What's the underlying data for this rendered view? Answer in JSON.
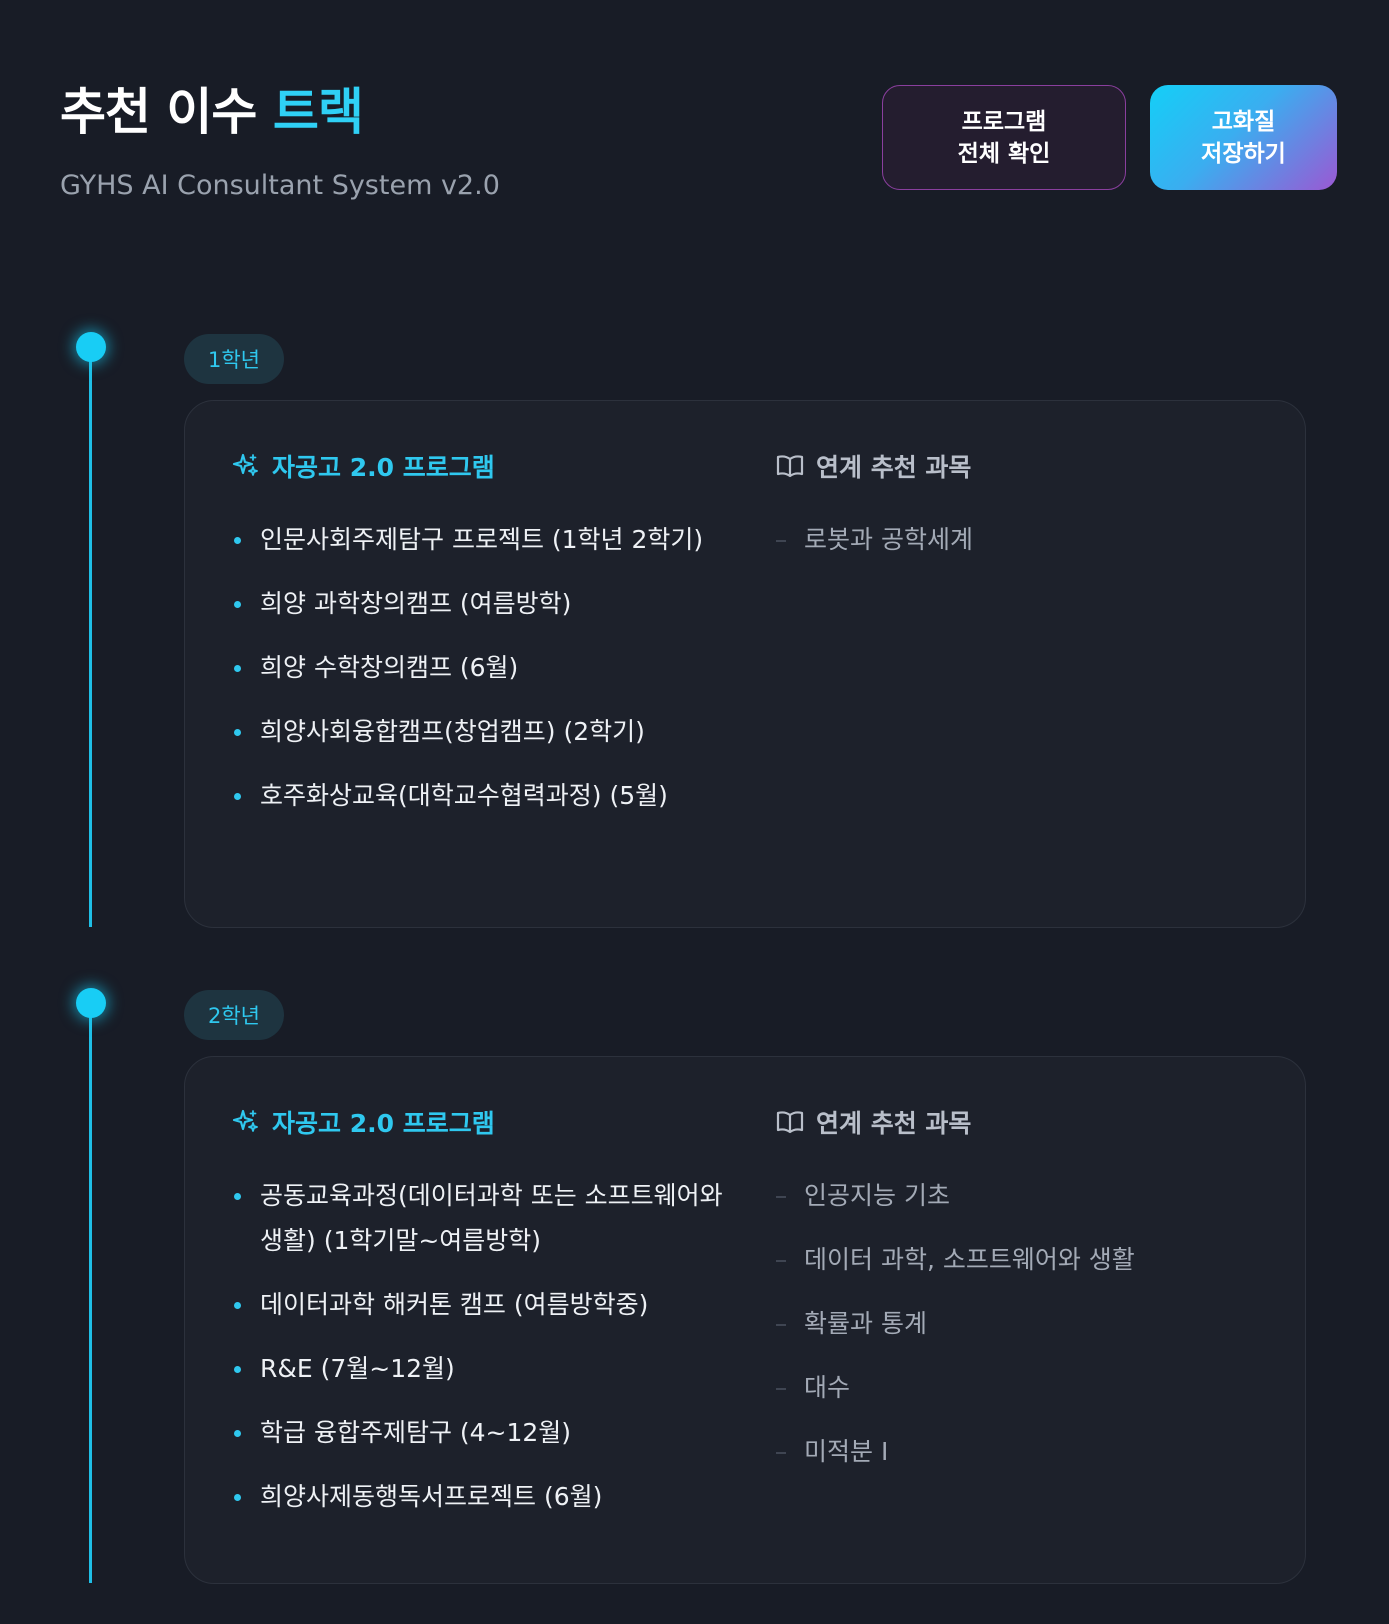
{
  "header": {
    "title_main": "추천 이수",
    "title_accent": "트랙",
    "subtitle": "GYHS AI Consultant System v2.0",
    "buttons": {
      "view_all": [
        "프로그램",
        "전체 확인"
      ],
      "save_hq": [
        "고화질",
        "저장하기"
      ]
    }
  },
  "colors": {
    "background": "#181c26",
    "accent": "#2fc8ef",
    "card": "#1d212b",
    "save_gradient": [
      "#14cff7",
      "#9b58d3"
    ]
  },
  "grades": [
    {
      "label": "1학년",
      "program_heading": "자공고 2.0 프로그램",
      "program_icon": "sparkle-icon",
      "course_heading": "연계 추천 과목",
      "course_icon": "book-icon",
      "programs": [
        "인문사회주제탐구 프로젝트 (1학년 2학기)",
        "희양 과학창의캠프 (여름방학)",
        "희양 수학창의캠프 (6월)",
        "희양사회융합캠프(창업캠프) (2학기)",
        "호주화상교육(대학교수협력과정) (5월)"
      ],
      "courses": [
        "로봇과 공학세계"
      ]
    },
    {
      "label": "2학년",
      "program_heading": "자공고 2.0 프로그램",
      "program_icon": "sparkle-icon",
      "course_heading": "연계 추천 과목",
      "course_icon": "book-icon",
      "programs": [
        "공동교육과정(데이터과학 또는 소프트웨어와 생활) (1학기말~여름방학)",
        "데이터과학 해커톤 캠프 (여름방학중)",
        "R&E (7월~12월)",
        "학급 융합주제탐구 (4~12월)",
        "희양사제동행독서프로젝트 (6월)"
      ],
      "courses": [
        "인공지능 기초",
        "데이터 과학, 소프트웨어와 생활",
        "확률과 통계",
        "대수",
        "미적분 I"
      ]
    }
  ]
}
